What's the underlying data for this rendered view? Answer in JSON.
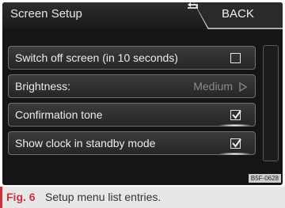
{
  "screen": {
    "title": "Screen Setup",
    "back_label": "BACK"
  },
  "rows": [
    {
      "label": "Switch off screen (in 10 seconds)",
      "control": "checkbox",
      "checked": false
    },
    {
      "label": "Brightness:",
      "control": "value",
      "value": "Medium"
    },
    {
      "label": "Confirmation tone",
      "control": "checkbox",
      "checked": true
    },
    {
      "label": "Show clock in standby mode",
      "control": "checkbox",
      "checked": true
    }
  ],
  "code_tag": "B5F-0628",
  "caption": {
    "label": "Fig. 6",
    "text": "Setup menu list entries."
  },
  "colors": {
    "screen_bg": "#151515",
    "caption_accent": "#c8323c"
  }
}
